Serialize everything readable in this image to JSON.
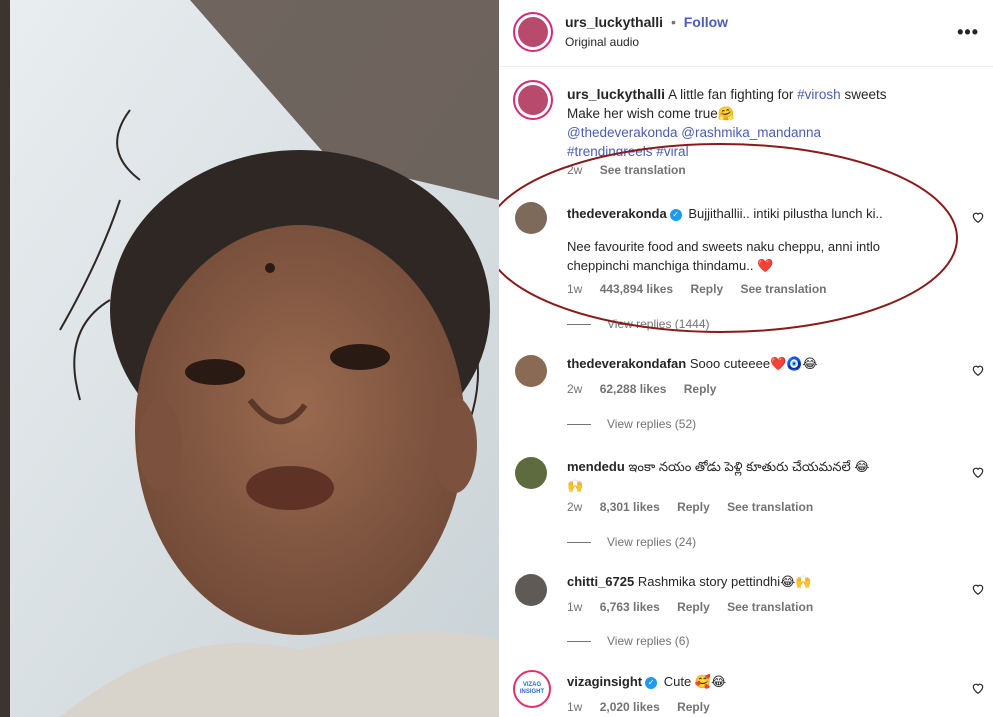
{
  "header": {
    "username": "urs_luckythalli",
    "dot": "•",
    "follow_label": "Follow",
    "audio": "Original audio",
    "more_icon": "more-horizontal-icon"
  },
  "caption": {
    "username": "urs_luckythalli",
    "text_before": "A little fan fighting for",
    "hashtag1": "#virosh",
    "text_after": "sweets",
    "line2": "Make her wish come true🤗",
    "mentions": "@thedeverakonda @rashmika_mandanna",
    "tags": "#trendingreels #viral",
    "time": "2w",
    "see_translation": "See translation"
  },
  "comments": [
    {
      "username": "thedeverakonda",
      "verified": true,
      "text": "Bujjithallii.. intiki pilustha lunch ki..",
      "text2": "Nee favourite food and sweets naku cheppu, anni intlo",
      "text3": "cheppinchi manchiga thindamu.. ❤️",
      "time": "1w",
      "likes": "443,894 likes",
      "reply": "Reply",
      "see_translation": "See translation",
      "view_replies": "View replies (1444)"
    },
    {
      "username": "thedeverakondafan",
      "text": "Sooo cuteeee❤️🧿😂",
      "time": "2w",
      "likes": "62,288 likes",
      "reply": "Reply",
      "view_replies": "View replies (52)"
    },
    {
      "username": "mendedu",
      "text": "ఇంకా నయం తోడు పెళ్లి కూతురు చేయమనలే 😂",
      "text2": "🙌",
      "time": "2w",
      "likes": "8,301 likes",
      "reply": "Reply",
      "see_translation": "See translation",
      "view_replies": "View replies (24)"
    },
    {
      "username": "chitti_6725",
      "text": "Rashmika story pettindhi😂🙌",
      "time": "1w",
      "likes": "6,763 likes",
      "reply": "Reply",
      "see_translation": "See translation",
      "view_replies": "View replies (6)"
    },
    {
      "username": "vizaginsight",
      "verified": true,
      "text": "Cute 🥰😂",
      "time": "1w",
      "likes": "2,020 likes",
      "reply": "Reply",
      "avatar_text": "VIZAG INSIGHT"
    }
  ],
  "colors": {
    "link_blue": "#4a5db3",
    "highlight_ring": "#8b1a1a",
    "muted": "#737373"
  }
}
